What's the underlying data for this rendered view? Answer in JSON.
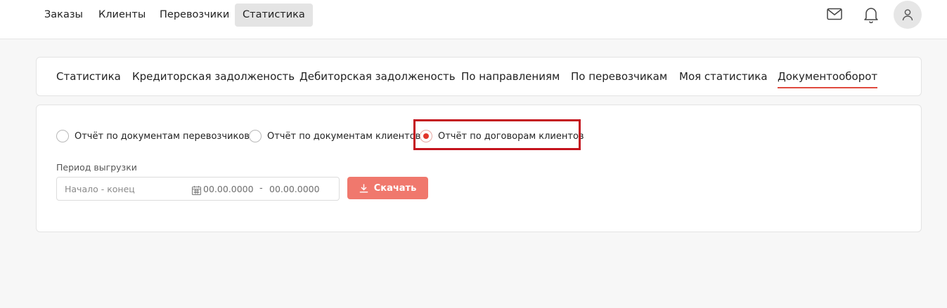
{
  "nav": {
    "items": [
      {
        "label": "Заказы"
      },
      {
        "label": "Клиенты"
      },
      {
        "label": "Перевозчики"
      },
      {
        "label": "Статистика",
        "active": true
      }
    ]
  },
  "header_icons": [
    "mail-icon",
    "bell-icon",
    "user-icon"
  ],
  "tabs": [
    {
      "label": "Статистика"
    },
    {
      "label": "Кредиторская задолженость"
    },
    {
      "label": "Дебиторская задолженость"
    },
    {
      "label": "По направлениям"
    },
    {
      "label": "По перевозчикам"
    },
    {
      "label": "Моя статистика"
    },
    {
      "label": "Документооборот",
      "active": true
    }
  ],
  "report_options": [
    {
      "label": "Отчёт по документам перевозчиков",
      "checked": false
    },
    {
      "label": "Отчёт по документам клиентов",
      "checked": false
    },
    {
      "label": "Отчёт по договорам клиентов",
      "checked": true
    }
  ],
  "period": {
    "label": "Период выгрузки",
    "placeholder": "Начало - конец",
    "start": "00.00.0000",
    "separator": "-",
    "end": "00.00.0000"
  },
  "download_button": {
    "label": "Скачать"
  },
  "colors": {
    "accent": "#e2362b",
    "button": "#f0786d",
    "highlight": "#c4131d",
    "tab_underline": "#e04a3f"
  }
}
